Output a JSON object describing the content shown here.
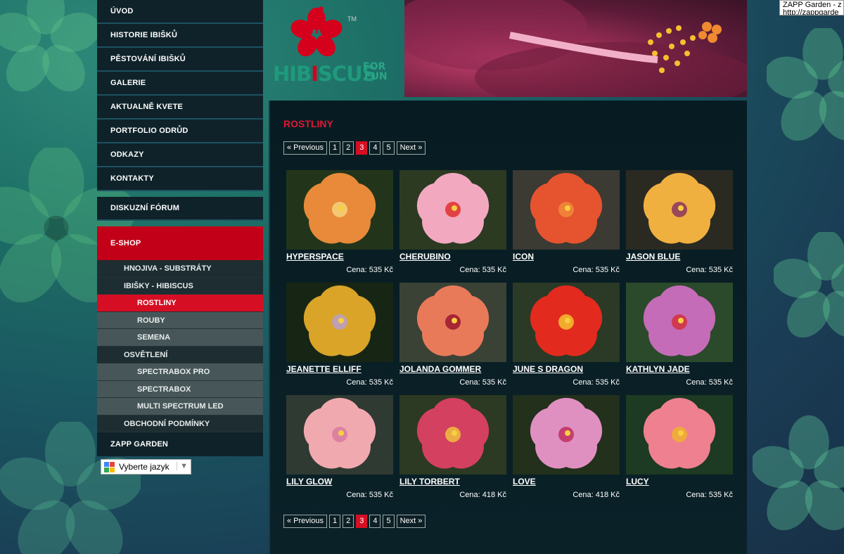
{
  "tooltip": {
    "line1": "ZAPP Garden - z",
    "line2": "http://zappgarde"
  },
  "nav": {
    "main": [
      "ÚVOD",
      "HISTORIE IBIŠKŮ",
      "PĚSTOVÁNÍ IBIŠKŮ",
      "GALERIE",
      "AKTUALNĚ KVETE",
      "PORTFOLIO ODRŮD",
      "ODKAZY",
      "KONTAKTY"
    ],
    "forum": "DISKUZNÍ FÓRUM",
    "eshop": "E-SHOP",
    "sub": {
      "fertilizers": "HNOJIVA - SUBSTRÁTY",
      "hibiscus": "IBIŠKY - HIBISCUS",
      "plants": "ROSTLINY",
      "cuttings": "ROUBY",
      "seeds": "SEMENA",
      "lighting": "OSVĚTLENÍ",
      "spectrabox_pro": "SPECTRABOX PRO",
      "spectrabox": "SPECTRABOX",
      "multi_led": "MULTI SPECTRUM LED",
      "terms": "OBCHODNÍ PODMÍNKY"
    },
    "zapp": "ZAPP GARDEN"
  },
  "language": {
    "label": "Vyberte jazyk"
  },
  "logo": {
    "main_a": "HIB",
    "main_i": "I",
    "main_b": "SCUS",
    "for": "FOR",
    "fun": "FUN",
    "tm": "TM"
  },
  "content": {
    "title": "ROSTLINY",
    "pager": {
      "prev": "« Previous",
      "pages": [
        "1",
        "2",
        "3",
        "4",
        "5"
      ],
      "current": "3",
      "next": "Next »"
    },
    "products": [
      {
        "name": "HYPERSPACE",
        "price": "Cena: 535 Kč",
        "petal": "#e88a3a",
        "center": "#f4d27a",
        "bg": "#22351b"
      },
      {
        "name": "CHERUBINO",
        "price": "Cena: 535 Kč",
        "petal": "#f2a9c0",
        "center": "#e0302e",
        "bg": "#2c3a22"
      },
      {
        "name": "ICON",
        "price": "Cena: 535 Kč",
        "petal": "#e5542e",
        "center": "#f18a3a",
        "bg": "#3b3a33"
      },
      {
        "name": "JASON BLUE",
        "price": "Cena: 535 Kč",
        "petal": "#f0b040",
        "center": "#8b3560",
        "bg": "#2a2a22"
      },
      {
        "name": "JEANETTE ELLIFF",
        "price": "Cena: 535 Kč",
        "petal": "#d9a428",
        "center": "#b8a0c8",
        "bg": "#172514"
      },
      {
        "name": "JOLANDA GOMMER",
        "price": "Cena: 535 Kč",
        "petal": "#e87a5a",
        "center": "#9a1830",
        "bg": "#3a4236"
      },
      {
        "name": "JUNE S DRAGON",
        "price": "Cena: 535 Kč",
        "petal": "#e22a1e",
        "center": "#f5c030",
        "bg": "#2a3a26"
      },
      {
        "name": "KATHLYN JADE",
        "price": "Cena: 535 Kč",
        "petal": "#c46cb8",
        "center": "#d43040",
        "bg": "#2b4a2c"
      },
      {
        "name": "LILY GLOW",
        "price": "Cena: 535 Kč",
        "petal": "#f1a9b0",
        "center": "#d87aa0",
        "bg": "#2f3a32"
      },
      {
        "name": "LILY TORBERT",
        "price": "Cena: 418 Kč",
        "petal": "#d44060",
        "center": "#f0c040",
        "bg": "#2c3a24"
      },
      {
        "name": "LOVE",
        "price": "Cena: 418 Kč",
        "petal": "#e090c0",
        "center": "#c03060",
        "bg": "#22301c"
      },
      {
        "name": "LUCY",
        "price": "Cena: 535 Kč",
        "petal": "#ee8090",
        "center": "#f0b030",
        "bg": "#1d3a22"
      }
    ]
  }
}
